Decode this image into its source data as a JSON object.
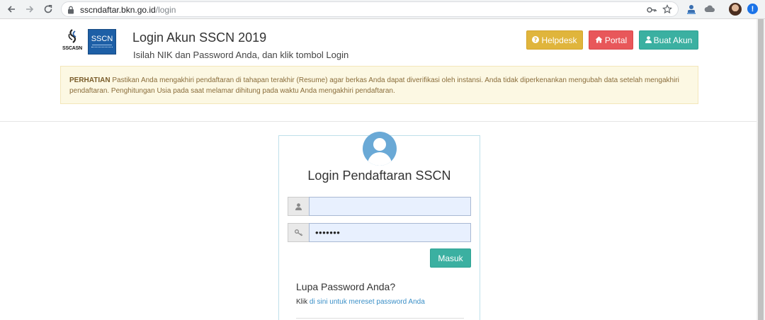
{
  "browser": {
    "url_host": "sscndaftar.bkn.go.id",
    "url_path": "/login"
  },
  "header": {
    "logo_text": "SSCASN",
    "logo_box_text": "SSCN",
    "title": "Login Akun SSCN 2019",
    "subtitle": "Isilah NIK dan Password Anda, dan klik tombol Login",
    "buttons": {
      "helpdesk": "Helpdesk",
      "portal": "Portal",
      "buat_akun": "Buat Akun"
    },
    "colors": {
      "helpdesk": "#e0b53c",
      "portal": "#e8575a",
      "buat_akun": "#3bb0a1"
    }
  },
  "alert": {
    "strong": "PERHATIAN",
    "text": " Pastikan Anda mengakhiri pendaftaran di tahapan terakhir (Resume) agar berkas Anda dapat diverifikasi oleh instansi. Anda tidak diperkenankan mengubah data setelah mengakhiri pendaftaran. Penghitungan Usia pada saat melamar dihitung pada waktu Anda mengakhiri pendaftaran."
  },
  "login": {
    "title": "Login Pendaftaran SSCN",
    "username_value": "",
    "password_value": "•••••••",
    "submit_label": "Masuk",
    "forgot_title": "Lupa Password Anda?",
    "forgot_prefix": "Klik ",
    "forgot_link": "di sini untuk mereset password Anda"
  },
  "icons": [
    "back-icon",
    "forward-icon",
    "reload-icon",
    "lock-icon",
    "key-icon",
    "star-icon",
    "user-icon",
    "key-small-icon",
    "question-icon",
    "home-icon"
  ]
}
